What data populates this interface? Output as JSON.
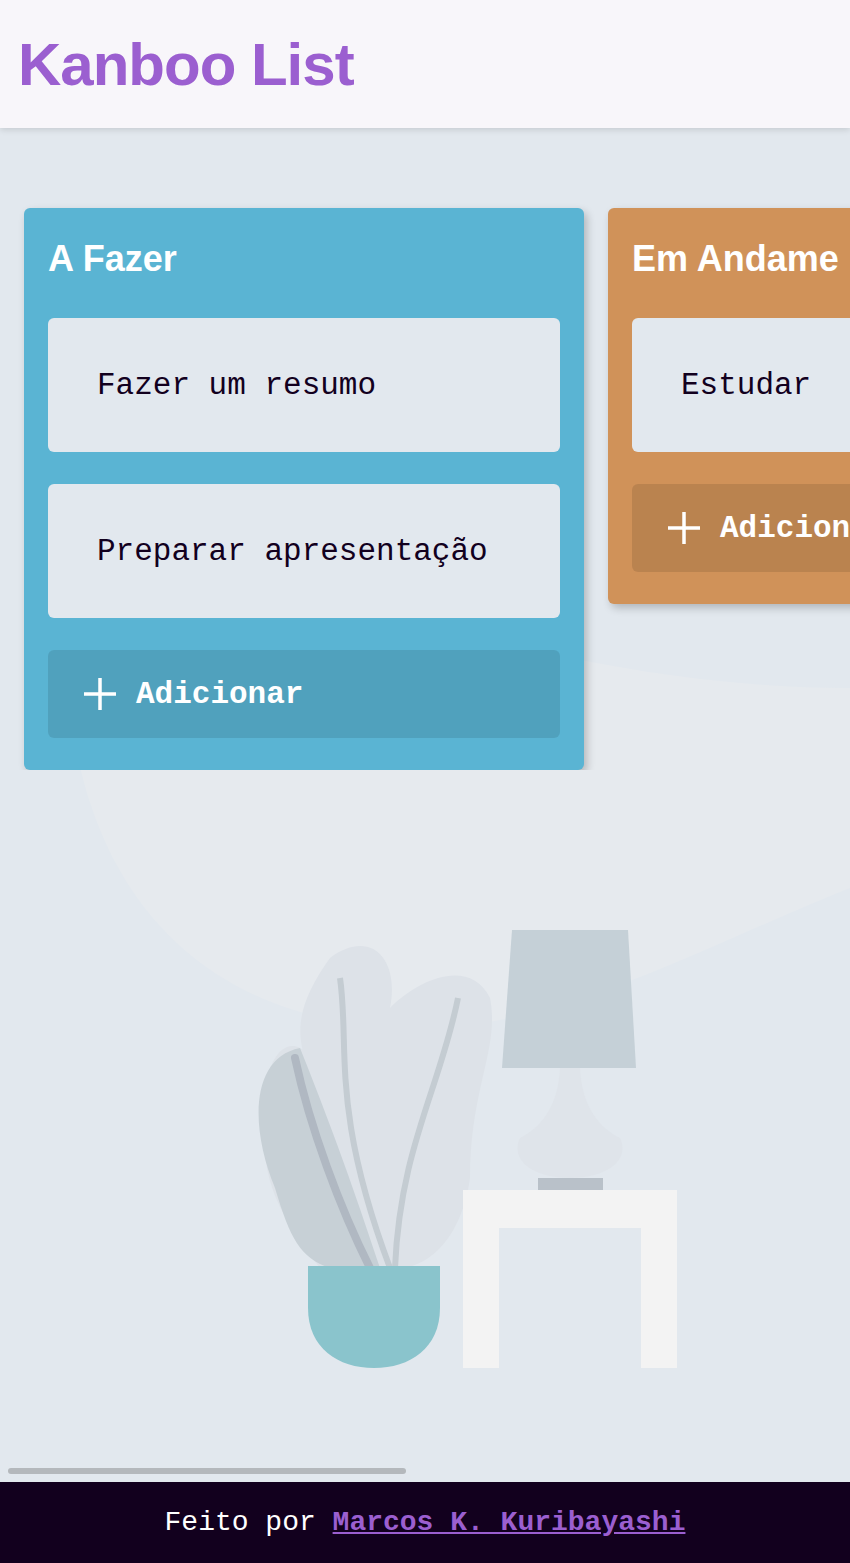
{
  "header": {
    "title": "Kanboo List"
  },
  "columns": [
    {
      "title": "A Fazer",
      "color": "#5ab4d3",
      "cards": [
        "Fazer um resumo",
        "Preparar apresentação"
      ],
      "add_label": "Adicionar"
    },
    {
      "title": "Em Andame",
      "color": "#d09259",
      "cards": [
        "Estudar"
      ],
      "add_label": "Adicion"
    }
  ],
  "footer": {
    "prefix": "Feito por ",
    "author": "Marcos K. Kuribayashi"
  }
}
